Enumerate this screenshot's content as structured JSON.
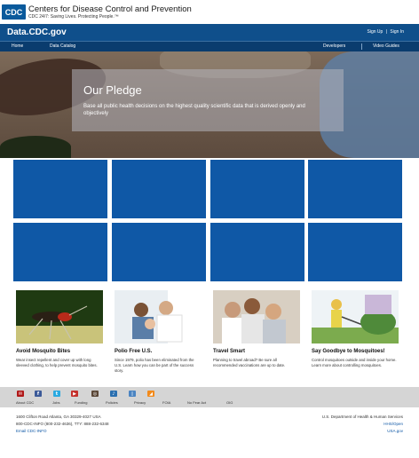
{
  "header": {
    "logo_text": "CDC",
    "org_title": "Centers for Disease Control and Prevention",
    "tagline": "CDC 24/7: Saving Lives. Protecting People.™"
  },
  "sitebar": {
    "site_name": "Data.CDC.gov",
    "sign_up": "Sign Up",
    "separator": "|",
    "sign_in": "Sign In"
  },
  "nav": {
    "home": "Home",
    "catalog": "Data Catalog",
    "developers": "Developers",
    "video_guides": "Video Guides"
  },
  "hero": {
    "title": "Our Pledge",
    "text": "Base all public health decisions on the highest quality scientific data that is derived openly and objectively"
  },
  "cards": [
    {
      "title": "Avoid Mosquito Bites",
      "desc": "Wear insect repellent and cover up with long sleeved clothing, to help prevent mosquito bites."
    },
    {
      "title": "Polio Free U.S.",
      "desc": "Since 1979, polio has been eliminated from the U.S. Learn how you can be part of the success story."
    },
    {
      "title": "Travel Smart",
      "desc": "Planning to travel abroad? Be sure all recommended vaccinations are up to date."
    },
    {
      "title": "Say Goodbye to Mosquitoes!",
      "desc": "Control mosquitoes outside and inside your home. Learn more about controlling mosquitoes."
    }
  ],
  "social_icons": [
    "email-icon",
    "facebook-icon",
    "twitter-icon",
    "youtube-icon",
    "instagram-icon",
    "podcast-icon",
    "mobile-icon",
    "rss-icon"
  ],
  "footer_links": [
    "About CDC",
    "Jobs",
    "Funding",
    "Policies",
    "Privacy",
    "FOIA",
    "No Fear Act",
    "OIG"
  ],
  "address": {
    "line1": "1600 Clifton Road Atlanta, GA 30329-4027 USA",
    "line2": "800-CDC-INFO (800-232-4636), TTY: 888-232-6348",
    "email": "Email CDC-INFO"
  },
  "right": {
    "hhs": "U.S. Department of Health & Human Services",
    "hhs_open": "HHS/Open",
    "usagov": "USA.gov"
  },
  "colors": {
    "brand_blue": "#0f4f8b",
    "tile_blue": "#0f58a6",
    "nav_dark": "#0a3c6e"
  }
}
